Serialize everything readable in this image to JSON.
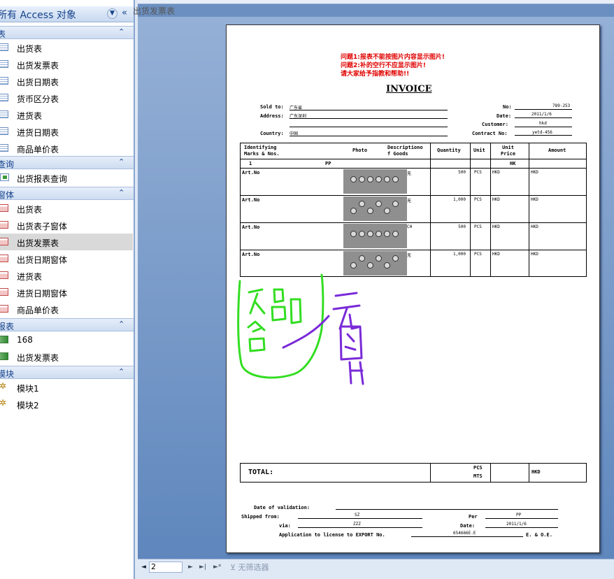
{
  "nav": {
    "header": "所有 Access 对象",
    "groups": [
      {
        "label": "表",
        "items": [
          "出货表",
          "出货发票表",
          "出货日期表",
          "货币区分表",
          "进货表",
          "进货日期表",
          "商品单价表"
        ]
      },
      {
        "label": "查询",
        "items": [
          "出货报表查询"
        ]
      },
      {
        "label": "窗体",
        "items": [
          "出货表",
          "出货表子窗体",
          "出货发票表",
          "出货日期窗体",
          "进货表",
          "进货日期窗体",
          "商品单价表"
        ]
      },
      {
        "label": "报表",
        "items": [
          "168",
          "出货发票表"
        ]
      },
      {
        "label": "模块",
        "items": [
          "模块1",
          "模块2"
        ]
      }
    ]
  },
  "document_tab": "出货发票表",
  "report": {
    "warnings": [
      "问题1:报表不能按图片内容显示图片!",
      "问题2:补的空行不应显示图片!",
      "请大家给予指教和帮助!!"
    ],
    "title": "INVOICE",
    "sold_to_label": "Sold to:",
    "sold_to": "广东省",
    "address_label": "Address:",
    "address": "广东深圳",
    "country_label": "Country:",
    "country": "中国",
    "no_label": "No:",
    "no": "789-253",
    "date_label": "Date:",
    "date": "2011/1/6",
    "customer_label": "Customer:",
    "customer": "hkd",
    "contract_label": "Contract No:",
    "contract": "yetd-456",
    "headers": {
      "marks": [
        "Identifying",
        "Marks & Nos."
      ],
      "photo": "Photo",
      "desc": [
        "Descriptiono",
        "f Goods"
      ],
      "qty": "Quantity",
      "unit": "Unit",
      "price": [
        "Unit",
        "Price"
      ],
      "amount": "Amount"
    },
    "subrow": {
      "num": "1",
      "code": "PP",
      "cur": "HK"
    },
    "rows": [
      {
        "art": "Art.No",
        "desc": "无",
        "qty": "500",
        "unit": "PCS",
        "price": "HKD",
        "amount": "HKD"
      },
      {
        "art": "Art.No",
        "desc": "无",
        "qty": "1,000",
        "unit": "PCS",
        "price": "HKD",
        "amount": "HKD"
      },
      {
        "art": "Art.No",
        "desc": "CH",
        "qty": "500",
        "unit": "PCS",
        "price": "HKD",
        "amount": "HKD"
      },
      {
        "art": "Art.No",
        "desc": "无",
        "qty": "1,000",
        "unit": "PCS",
        "price": "HKD",
        "amount": "HKD"
      }
    ],
    "total_label": "TOTAL:",
    "total_unit1": "PCS",
    "total_unit2": "MTS",
    "total_amount": "HKD",
    "validation_label": "Date of validation:",
    "shipped_label": "Shipped from:",
    "shipped": "SZ",
    "via_label": "via:",
    "via": "ZZZ",
    "per_label": "Per",
    "per": "PP",
    "date2_label": "Date:",
    "date2": "2011/1/6",
    "license_label": "Application to license to EXPORT No.",
    "license": "654666E.E",
    "eoe": "E. & O.E."
  },
  "scribble_colors": {
    "green": "#33dd22",
    "purple": "#7a2ad8"
  },
  "pager": {
    "page": "2",
    "filter": "无筛选器"
  }
}
